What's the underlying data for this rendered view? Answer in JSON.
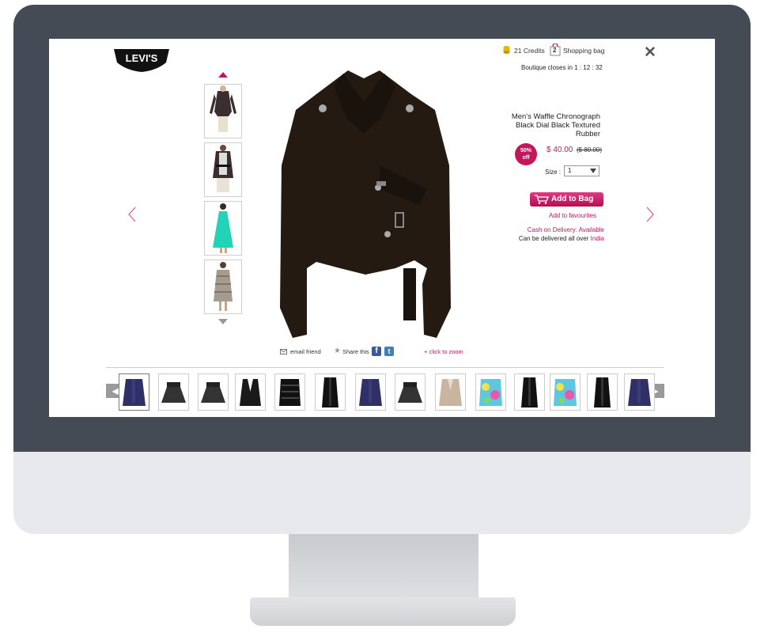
{
  "brand": {
    "logo_text": "LEVI'S"
  },
  "header": {
    "credits": "21 Credits",
    "bag_count": "2",
    "bag_label": "Shopping bag",
    "close_icon": "close-icon",
    "timer": "Boutique closes in 1 : 12 : 32"
  },
  "product": {
    "title": "Men's Waffle Chronograph Black Dial Black Textured Rubber",
    "discount_line1": "50%",
    "discount_line2": "off",
    "price": "$ 40.00",
    "old_price": "($ 80.00)",
    "size_label": "Size :",
    "size_value": "1",
    "add_to_bag": "Add to Bag",
    "favourites": "Add to favourites",
    "cod": "Cash on Delivery: Available",
    "delivery_prefix": "Can be delivered all over ",
    "delivery_location": "India"
  },
  "share": {
    "email": "email friend",
    "share_label": "Share this",
    "fb": "f",
    "tw": "t",
    "zoom": "+ click to zoom"
  },
  "vertical_thumbs": [
    "blazer",
    "blazer-belted",
    "teal-dress",
    "fur-dress"
  ],
  "carousel": [
    "navy-cardigan",
    "black-skirt",
    "black-skirt",
    "black-blazer",
    "black-fur-jacket",
    "black-vest",
    "navy-cardigan",
    "black-skirt",
    "beige-jacket",
    "print-skirt",
    "black-vest",
    "print-skirt",
    "black-vest",
    "navy-cardigan"
  ],
  "colors": {
    "accent": "#c2185b",
    "bezel": "#444b55"
  }
}
